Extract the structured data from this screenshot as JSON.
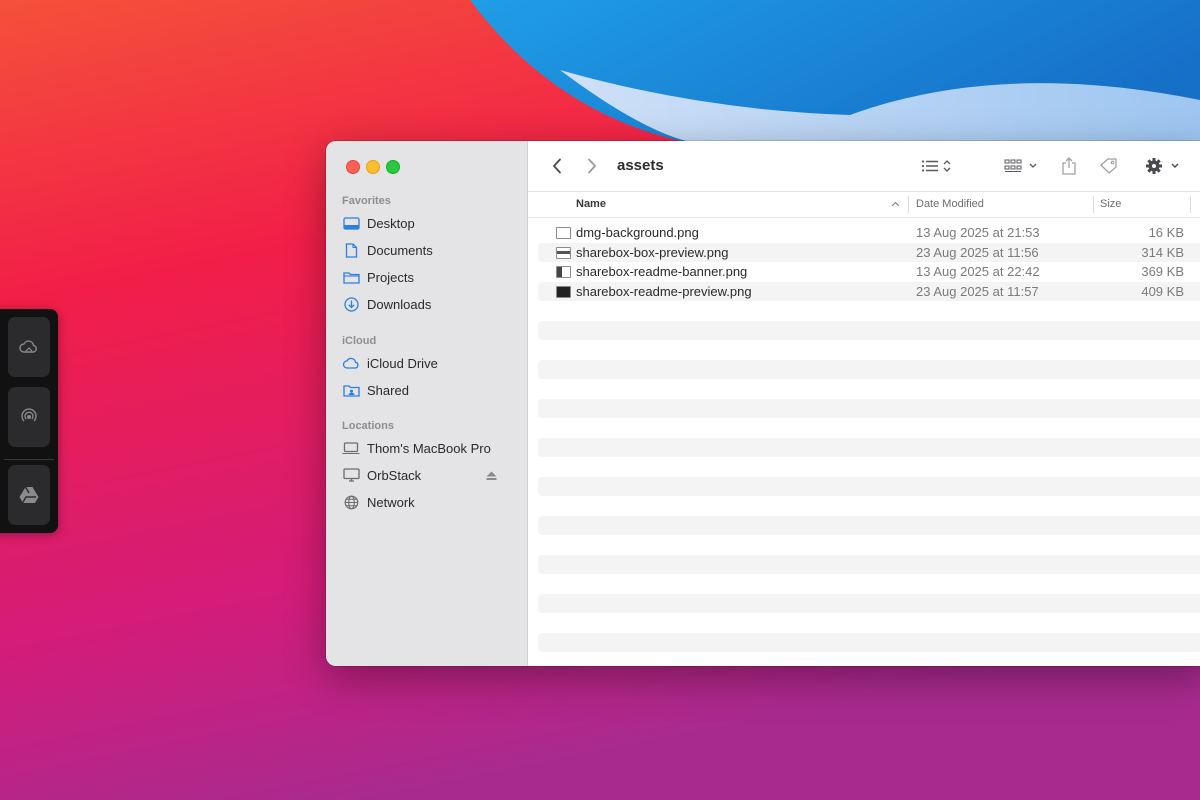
{
  "colors": {
    "traffic_red": "#fe5f57",
    "traffic_yellow": "#febc2e",
    "traffic_green": "#28c840",
    "sidebar_icon_blue": "#2b7fe0"
  },
  "dock": {
    "items": [
      {
        "icon": "cloud-icon"
      },
      {
        "icon": "airdrop-icon"
      },
      {
        "icon": "google-drive-icon"
      }
    ]
  },
  "finder": {
    "title": "assets",
    "sidebar": {
      "sections": [
        {
          "heading": "Favorites",
          "items": [
            {
              "label": "Desktop",
              "icon": "desktop-icon"
            },
            {
              "label": "Documents",
              "icon": "document-icon"
            },
            {
              "label": "Projects",
              "icon": "folder-icon"
            },
            {
              "label": "Downloads",
              "icon": "download-icon"
            }
          ]
        },
        {
          "heading": "iCloud",
          "items": [
            {
              "label": "iCloud Drive",
              "icon": "cloud-icon"
            },
            {
              "label": "Shared",
              "icon": "shared-folder-icon"
            }
          ]
        },
        {
          "heading": "Locations",
          "items": [
            {
              "label": "Thom's MacBook Pro",
              "icon": "laptop-icon"
            },
            {
              "label": "OrbStack",
              "icon": "display-icon"
            },
            {
              "label": "Network",
              "icon": "globe-icon"
            }
          ]
        }
      ]
    },
    "columns": {
      "name": "Name",
      "date": "Date Modified",
      "size": "Size"
    },
    "files": [
      {
        "name": "dmg-background.png",
        "date": "13 Aug 2025 at 21:53",
        "size": "16 KB"
      },
      {
        "name": "sharebox-box-preview.png",
        "date": "23 Aug 2025 at 11:56",
        "size": "314 KB"
      },
      {
        "name": "sharebox-readme-banner.png",
        "date": "13 Aug 2025 at 22:42",
        "size": "369 KB"
      },
      {
        "name": "sharebox-readme-preview.png",
        "date": "23 Aug 2025 at 11:57",
        "size": "409 KB"
      }
    ]
  }
}
